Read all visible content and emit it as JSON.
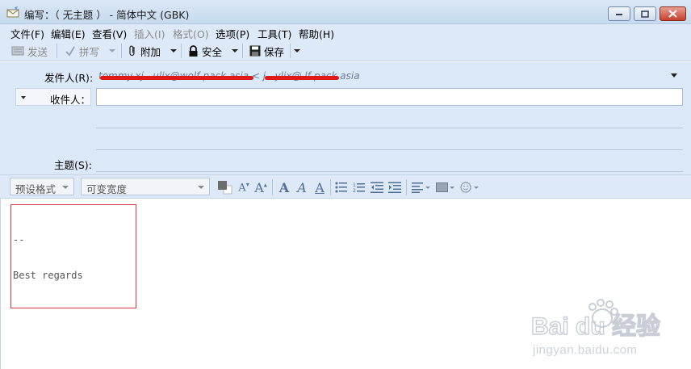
{
  "window": {
    "title": "编写：（ 无主题 ） - 简体中文 (GBK)"
  },
  "menu": [
    {
      "label": "文件(F)",
      "disabled": false
    },
    {
      "label": "编辑(E)",
      "disabled": false
    },
    {
      "label": "查看(V)",
      "disabled": false
    },
    {
      "label": "插入(I)",
      "disabled": true
    },
    {
      "label": "格式(O)",
      "disabled": true
    },
    {
      "label": "选项(P)",
      "disabled": false
    },
    {
      "label": "工具(T)",
      "disabled": false
    },
    {
      "label": "帮助(H)",
      "disabled": false
    }
  ],
  "toolbar": {
    "send_label": "发送",
    "spell_label": "拼写",
    "attach_label": "附加",
    "security_label": "安全",
    "save_label": "保存"
  },
  "header": {
    "from_label": "发件人(R):",
    "from_value": "tommy.xj   .  ulix@wolf-pack.asia  <  j    .  ylix@     lf-pack.asia",
    "to_label": "收件人：",
    "subject_label": "主题(S):"
  },
  "format": {
    "paragraph_style": "预设格式",
    "font_family": "可变宽度"
  },
  "body": {
    "signature_separator": "--",
    "signature_text": "Best regards"
  },
  "watermark": {
    "brand": "Bai du 经验",
    "url": "jingyan.baidu.com"
  },
  "colors": {
    "chrome": "#dde9f7",
    "accent_red": "#e01818",
    "icon_blue": "#4f6f96"
  }
}
